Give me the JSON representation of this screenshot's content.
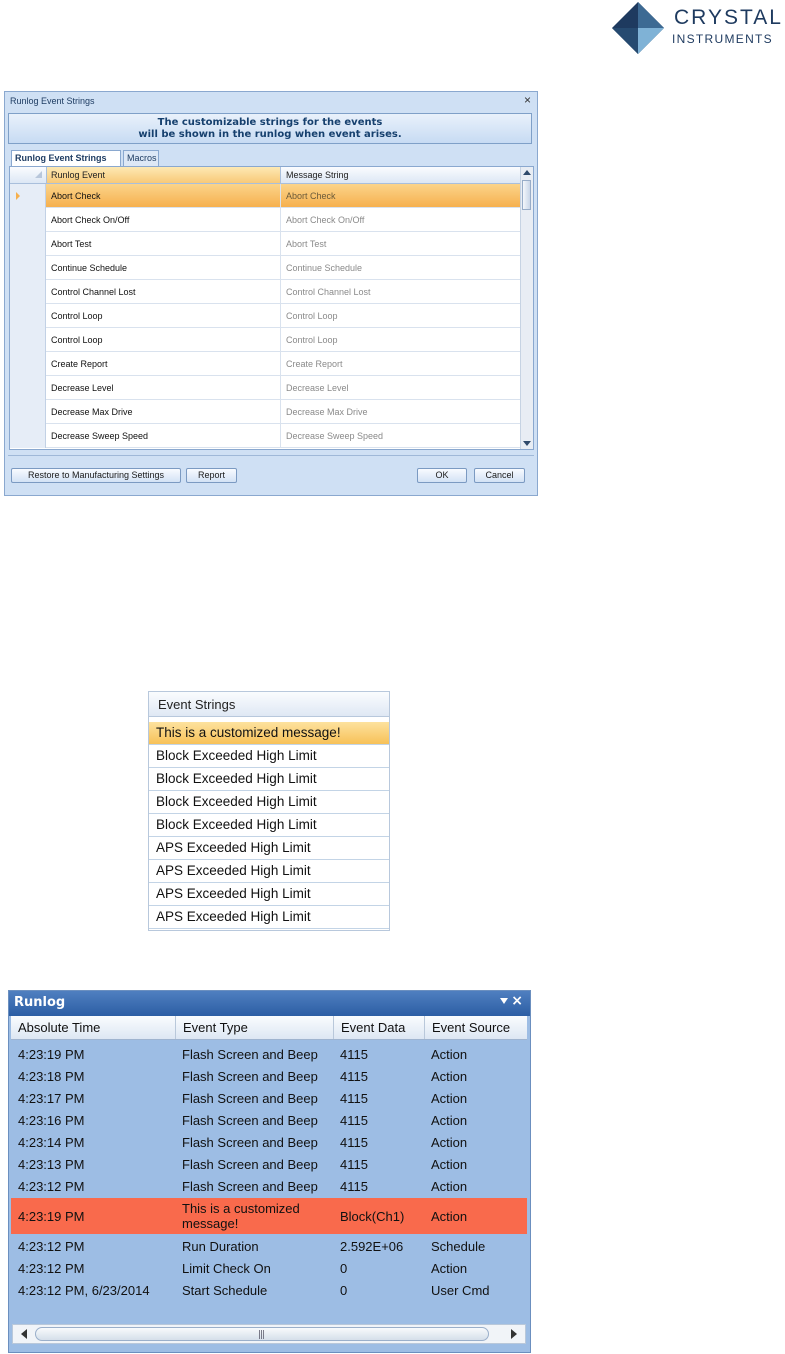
{
  "logo": {
    "line1": "CRYSTAL",
    "line2": "INSTRUMENTS",
    "colors": {
      "navy": "#1e3a5f",
      "light": "#7fb2d6"
    }
  },
  "dialog": {
    "title": "Runlog Event Strings",
    "close_label": "×",
    "header_line1": "The customizable strings for the events",
    "header_line2": "will be shown in the runlog when event arises.",
    "tabs": [
      {
        "label": "Runlog Event Strings",
        "active": true
      },
      {
        "label": "Macros",
        "active": false
      }
    ],
    "columns": {
      "event": "Runlog Event",
      "message": "Message String"
    },
    "rows": [
      {
        "event": "Abort Check",
        "message": "Abort Check"
      },
      {
        "event": "Abort Check On/Off",
        "message": "Abort Check On/Off"
      },
      {
        "event": "Abort Test",
        "message": "Abort Test"
      },
      {
        "event": "Continue Schedule",
        "message": "Continue Schedule"
      },
      {
        "event": "Control Channel Lost",
        "message": "Control Channel Lost"
      },
      {
        "event": "Control Loop",
        "message": "Control Loop"
      },
      {
        "event": "Control Loop",
        "message": "Control Loop"
      },
      {
        "event": "Create Report",
        "message": "Create Report"
      },
      {
        "event": "Decrease Level",
        "message": "Decrease Level"
      },
      {
        "event": "Decrease Max Drive",
        "message": "Decrease Max Drive"
      },
      {
        "event": "Decrease Sweep Speed",
        "message": "Decrease Sweep Speed"
      }
    ],
    "buttons": {
      "restore": "Restore to Manufacturing Settings",
      "report": "Report",
      "ok": "OK",
      "cancel": "Cancel"
    }
  },
  "event_strings": {
    "header": "Event Strings",
    "rows": [
      "This is a customized message!",
      "Block Exceeded High Limit",
      "Block Exceeded High Limit",
      "Block Exceeded High Limit",
      "Block Exceeded High Limit",
      "APS Exceeded High Limit",
      "APS Exceeded High Limit",
      "APS Exceeded High Limit",
      "APS Exceeded High Limit"
    ]
  },
  "runlog": {
    "title": "Runlog",
    "close_label": "×",
    "columns": [
      "Absolute Time",
      "Event Type",
      "Event Data",
      "Event Source"
    ],
    "rows": [
      {
        "time": "4:23:19 PM",
        "type": "Flash Screen and Beep",
        "data": "4115",
        "source": "Action"
      },
      {
        "time": "4:23:18 PM",
        "type": "Flash Screen and Beep",
        "data": "4115",
        "source": "Action"
      },
      {
        "time": "4:23:17 PM",
        "type": "Flash Screen and Beep",
        "data": "4115",
        "source": "Action"
      },
      {
        "time": "4:23:16 PM",
        "type": "Flash Screen and Beep",
        "data": "4115",
        "source": "Action"
      },
      {
        "time": "4:23:14 PM",
        "type": "Flash Screen and Beep",
        "data": "4115",
        "source": "Action"
      },
      {
        "time": "4:23:13 PM",
        "type": "Flash Screen and Beep",
        "data": "4115",
        "source": "Action"
      },
      {
        "time": "4:23:12 PM",
        "type": "Flash Screen and Beep",
        "data": "4115",
        "source": "Action"
      },
      {
        "time": "4:23:19 PM",
        "type": "This is a customized message!",
        "data": "Block(Ch1)",
        "source": "Action",
        "highlight": true
      },
      {
        "time": "4:23:12 PM",
        "type": "Run Duration",
        "data": "2.592E+06",
        "source": "Schedule"
      },
      {
        "time": "4:23:12 PM",
        "type": "Limit Check On",
        "data": "0",
        "source": "Action"
      },
      {
        "time": "4:23:12 PM, 6/23/2014",
        "type": "Start Schedule",
        "data": "0",
        "source": "User Cmd"
      }
    ],
    "grip": "|||"
  },
  "colors": {
    "selection_orange": "#f6b04e",
    "highlight_red": "#f96a4c",
    "panel_blue": "#9dbde4",
    "title_blue": "#2c5ea4"
  }
}
